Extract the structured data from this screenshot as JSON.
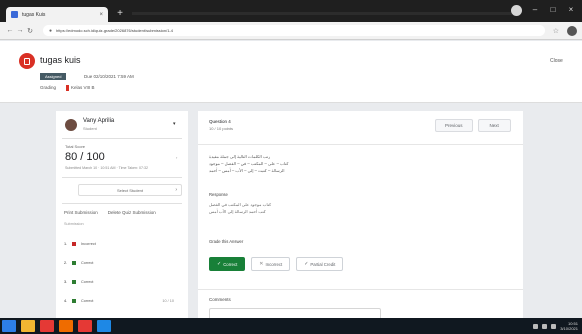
{
  "browser": {
    "tab_title": "tugas Kuis",
    "tab_close": "×",
    "new_tab": "+",
    "minimize": "–",
    "maximize": "□",
    "close": "×",
    "back": "←",
    "forward": "→",
    "reload": "↻",
    "url": "https://edmodo.sch.id/quiz-grade/2026876/student/submission/1-4",
    "star": "☆"
  },
  "header": {
    "title": "tugas kuis",
    "status": "Assigned",
    "due": "Due 02/10/2021 7:59 AM",
    "grading_label": "Grading",
    "class_name": "Kelas VIII B",
    "close_label": "Close"
  },
  "student": {
    "name": "Vany Aprilia",
    "sub": "Student",
    "caret": "▾"
  },
  "score": {
    "label": "Total Score",
    "value": "80 / 100",
    "meta": "Submitted March 10 · 10:51 AM · Time Taken: 07:32",
    "caret": "›",
    "select_label": "Select Student",
    "select_caret": "›"
  },
  "submission": {
    "print_label": "Print Submission",
    "delete_label": "Delete Quiz Submission",
    "list_label": "Submission",
    "rows": [
      {
        "num": "1.",
        "status": "Incorrect",
        "color": "#c62828",
        "points": ""
      },
      {
        "num": "2.",
        "status": "Correct",
        "color": "#2e7d32",
        "points": ""
      },
      {
        "num": "3.",
        "status": "Correct",
        "color": "#2e7d32",
        "points": ""
      },
      {
        "num": "4.",
        "status": "Correct",
        "color": "#2e7d32",
        "points": "10 / 10"
      }
    ]
  },
  "question": {
    "title": "Question 4",
    "points": "10 / 10 points",
    "previous": "Previous",
    "next": "Next",
    "body_lines": [
      "رتب الكلمات التالية إلى جملة مفيدة",
      "كتاب – على – المكتب – في – الفصل – موجود",
      "الرسالة – كتبت – إلى – الأب – أمس – أحمد"
    ],
    "response_label": "Response",
    "response_lines": [
      "كتاب موجود على المكتب في الفصل",
      "كتب أحمد الرسالة إلى الأب أمس"
    ],
    "grade_label": "Grade this Answer",
    "correct": "Correct",
    "incorrect": "Incorrect",
    "partial": "Partial Credit",
    "check_icon": "✓",
    "x_icon": "✕",
    "comments_label": "Comments"
  },
  "taskbar": {
    "icons": [
      {
        "name": "windows-start-icon",
        "color": "#2d7ee8"
      },
      {
        "name": "file-explorer-icon",
        "color": "#f2b632"
      },
      {
        "name": "chrome-icon",
        "color": "#e53935"
      },
      {
        "name": "media-player-icon",
        "color": "#ef6c00"
      },
      {
        "name": "app-icon",
        "color": "#e53935"
      },
      {
        "name": "app-icon-2",
        "color": "#1e88e5"
      }
    ],
    "time": "10:51",
    "date": "3/10/2021"
  },
  "colors": {
    "accent_red": "#d93025",
    "correct_green": "#188038"
  }
}
